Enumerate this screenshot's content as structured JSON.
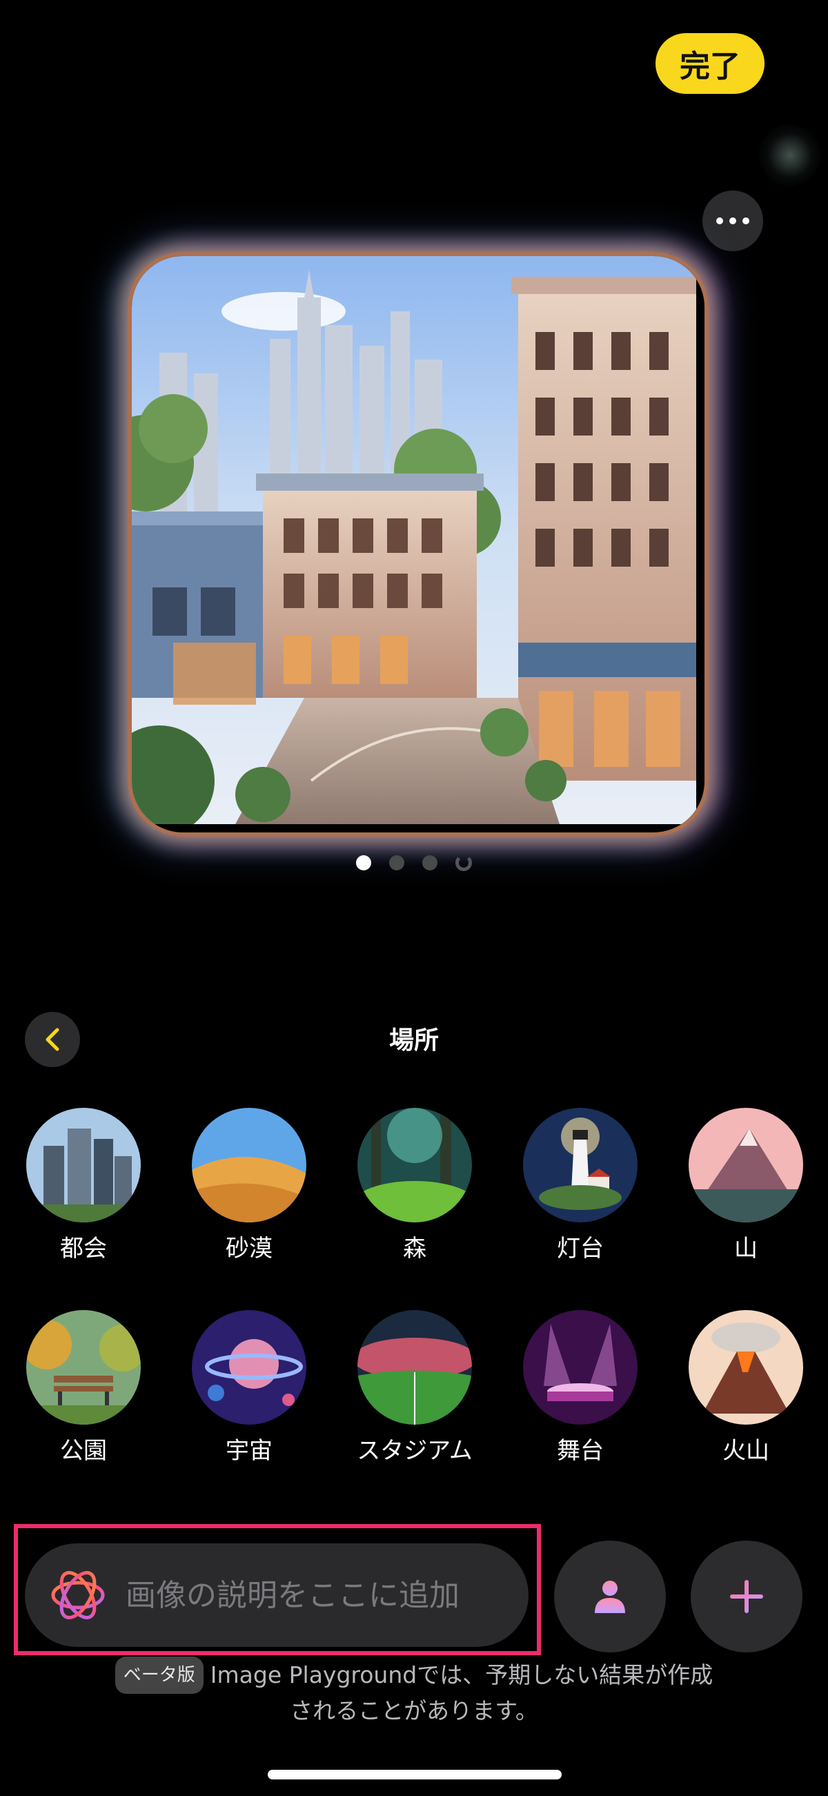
{
  "header": {
    "done_label": "完了"
  },
  "image_card": {
    "pages": 4,
    "active_page": 1,
    "loading_page": 4
  },
  "category": {
    "title": "場所",
    "items": [
      {
        "label": "都会",
        "icon": "city-icon"
      },
      {
        "label": "砂漠",
        "icon": "desert-icon"
      },
      {
        "label": "森",
        "icon": "forest-icon"
      },
      {
        "label": "灯台",
        "icon": "lighthouse-icon"
      },
      {
        "label": "山",
        "icon": "mountain-icon"
      },
      {
        "label": "公園",
        "icon": "park-icon"
      },
      {
        "label": "宇宙",
        "icon": "space-icon"
      },
      {
        "label": "スタジアム",
        "icon": "stadium-icon"
      },
      {
        "label": "舞台",
        "icon": "stage-icon"
      },
      {
        "label": "火山",
        "icon": "volcano-icon"
      }
    ]
  },
  "prompt": {
    "placeholder": "画像の説明をここに追加"
  },
  "footer": {
    "beta_badge": "ベータ版",
    "disclaimer_line1": "Image Playgroundでは、予期しない結果が作成",
    "disclaimer_line2": "されることがあります。"
  },
  "colors": {
    "accent": "#f9d71c",
    "highlight": "#ef2b6e",
    "background": "#000000"
  }
}
